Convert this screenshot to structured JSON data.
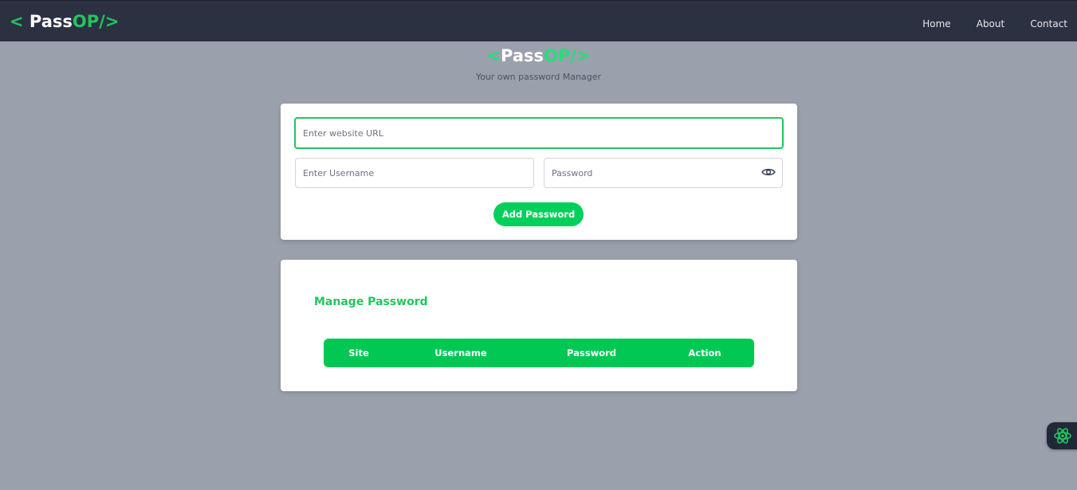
{
  "navbar": {
    "logo": {
      "bracket_open": "< ",
      "pass": "Pass",
      "op": "OP/>"
    },
    "links": [
      "Home",
      "About",
      "Contact"
    ]
  },
  "hero": {
    "logo": {
      "bracket_open": "<",
      "pass": "Pass",
      "op": "OP/>"
    },
    "subtitle": "Your own password Manager"
  },
  "form": {
    "url_placeholder": "Enter website URL",
    "url_value": "",
    "username_placeholder": "Enter Username",
    "username_value": "",
    "password_placeholder": "Password",
    "password_value": "",
    "add_button_label": "Add Password",
    "toggle_icon": "eye-icon"
  },
  "manage": {
    "title": "Manage Password",
    "columns": [
      "Site",
      "Username",
      "Password",
      "Action"
    ]
  },
  "widget": {
    "icon": "atom-icon"
  },
  "colors": {
    "accent": "#22c55e",
    "button": "#00d05a",
    "table_header": "#00c853",
    "navbar": "#2c3142",
    "page_background": "#9aa0ac"
  }
}
